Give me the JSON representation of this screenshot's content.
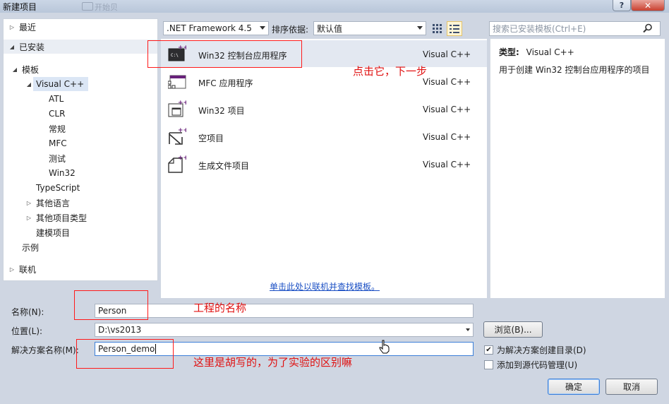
{
  "window": {
    "title": "新建项目",
    "ghost_tab": "开始贝",
    "help_label": "?",
    "close_label": "✕"
  },
  "nav": {
    "recent": "最近",
    "installed": "已安装",
    "templates": "模板",
    "visual_cpp": "Visual C++",
    "atl": "ATL",
    "clr": "CLR",
    "general": "常规",
    "mfc": "MFC",
    "test": "测试",
    "win32": "Win32",
    "typescript": "TypeScript",
    "other_languages": "其他语言",
    "other_project_types": "其他项目类型",
    "modeling_projects": "建模项目",
    "samples": "示例",
    "online": "联机"
  },
  "toolbar": {
    "framework": ".NET Framework 4.5",
    "sort_label": "排序依据:",
    "sort_value": "默认值",
    "search_placeholder": "搜索已安装模板(Ctrl+E)"
  },
  "templates": [
    {
      "name": "Win32 控制台应用程序",
      "lang": "Visual C++",
      "icon": "console-app-icon"
    },
    {
      "name": "MFC 应用程序",
      "lang": "Visual C++",
      "icon": "mfc-app-icon"
    },
    {
      "name": "Win32 项目",
      "lang": "Visual C++",
      "icon": "win32-project-icon"
    },
    {
      "name": "空项目",
      "lang": "Visual C++",
      "icon": "empty-project-icon"
    },
    {
      "name": "生成文件项目",
      "lang": "Visual C++",
      "icon": "makefile-project-icon"
    }
  ],
  "online_link": "单击此处以联机并查找模板。",
  "description": {
    "type_label": "类型:",
    "type_value": "Visual C++",
    "text": "用于创建 Win32 控制台应用程序的项目"
  },
  "form": {
    "name_label": "名称(N):",
    "name_value": "Person",
    "location_label": "位置(L):",
    "location_value": "D:\\vs2013",
    "solution_label": "解决方案名称(M):",
    "solution_value": "Person_demo",
    "browse_label": "浏览(B)...",
    "create_dir_label": "为解决方案创建目录(D)",
    "create_dir_checked": true,
    "source_control_label": "添加到源代码管理(U)",
    "source_control_checked": false,
    "ok_label": "确定",
    "cancel_label": "取消"
  },
  "annotations": {
    "click_next": "点击它，下一步",
    "project_name": "工程的名称",
    "solution_note": "这里是胡写的，为了实验的区别嘛"
  },
  "colors": {
    "annotation_red": "#ff1a1a",
    "link_blue": "#1a4fc4",
    "dialog_bg": "#cfd6e2"
  }
}
